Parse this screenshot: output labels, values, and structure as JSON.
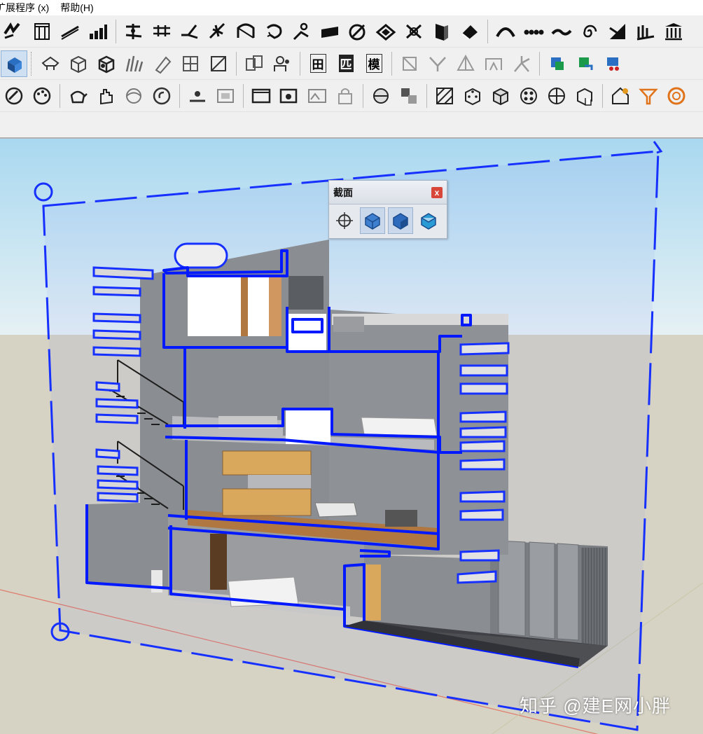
{
  "menubar": {
    "items": [
      "扩展程序 (x)",
      "帮助(H)"
    ]
  },
  "toolbars": {
    "row1_icons": [
      "freehand-icon",
      "column-icon",
      "stairs-icon",
      "bar-steps-icon",
      "axis-icon",
      "parallel-lines-icon",
      "bend-icon",
      "tree-icon",
      "arch-icon",
      "rotate-icon",
      "person-icon",
      "slab-icon",
      "target-icon",
      "diamond-icon",
      "copy-icon",
      "door-icon",
      "eraser-icon",
      "curve-icon",
      "dots-icon",
      "wave-icon",
      "spiral-icon",
      "cut-icon",
      "bars-icon",
      "columns-icon"
    ],
    "row2_icons": [
      "select-cube-icon",
      "camera-icon",
      "box-icon",
      "box-paint-icon",
      "grass-icon",
      "pencil-icon",
      "grid-icon",
      "fold-icon",
      "components-icon",
      "people-icon",
      "text-field-icon",
      "text-ce-icon",
      "text-ba-icon",
      "ortho-icon",
      "split-icon",
      "pyramid-icon",
      "face-icon",
      "tripod-icon",
      "export-a-icon",
      "export-b-icon",
      "export-c-icon"
    ],
    "row2_text": {
      "b1": "田",
      "b2": "匹",
      "b3": "模"
    },
    "row3_icons": [
      "style-icon",
      "palette-icon",
      "teapot-icon",
      "hand-icon",
      "shade-icon",
      "undo-icon",
      "ground-icon",
      "frame-icon",
      "window-icon",
      "window-export-icon",
      "image-icon",
      "lock-icon",
      "sphere-icon",
      "duplicate-icon",
      "texture-icon",
      "cube-a-icon",
      "cube-b-icon",
      "ball-icon",
      "ball-b-icon",
      "cube-hand-icon",
      "house-gear-icon",
      "funnel-icon",
      "ring-icon"
    ]
  },
  "section_panel": {
    "title": "截面",
    "close_label": "x",
    "buttons": [
      "section-plane-icon",
      "display-cuts-icon",
      "display-planes-icon",
      "section-fill-icon"
    ]
  },
  "watermark": "知乎 @建E网小胖",
  "colors": {
    "sky_top": "#a9d8f0",
    "sky_bottom": "#e6f1f4",
    "ground": "#d6d3c4",
    "section_blue": "#0019ff",
    "building_gray": "#8a8d92",
    "wood": "#d9a85c"
  }
}
